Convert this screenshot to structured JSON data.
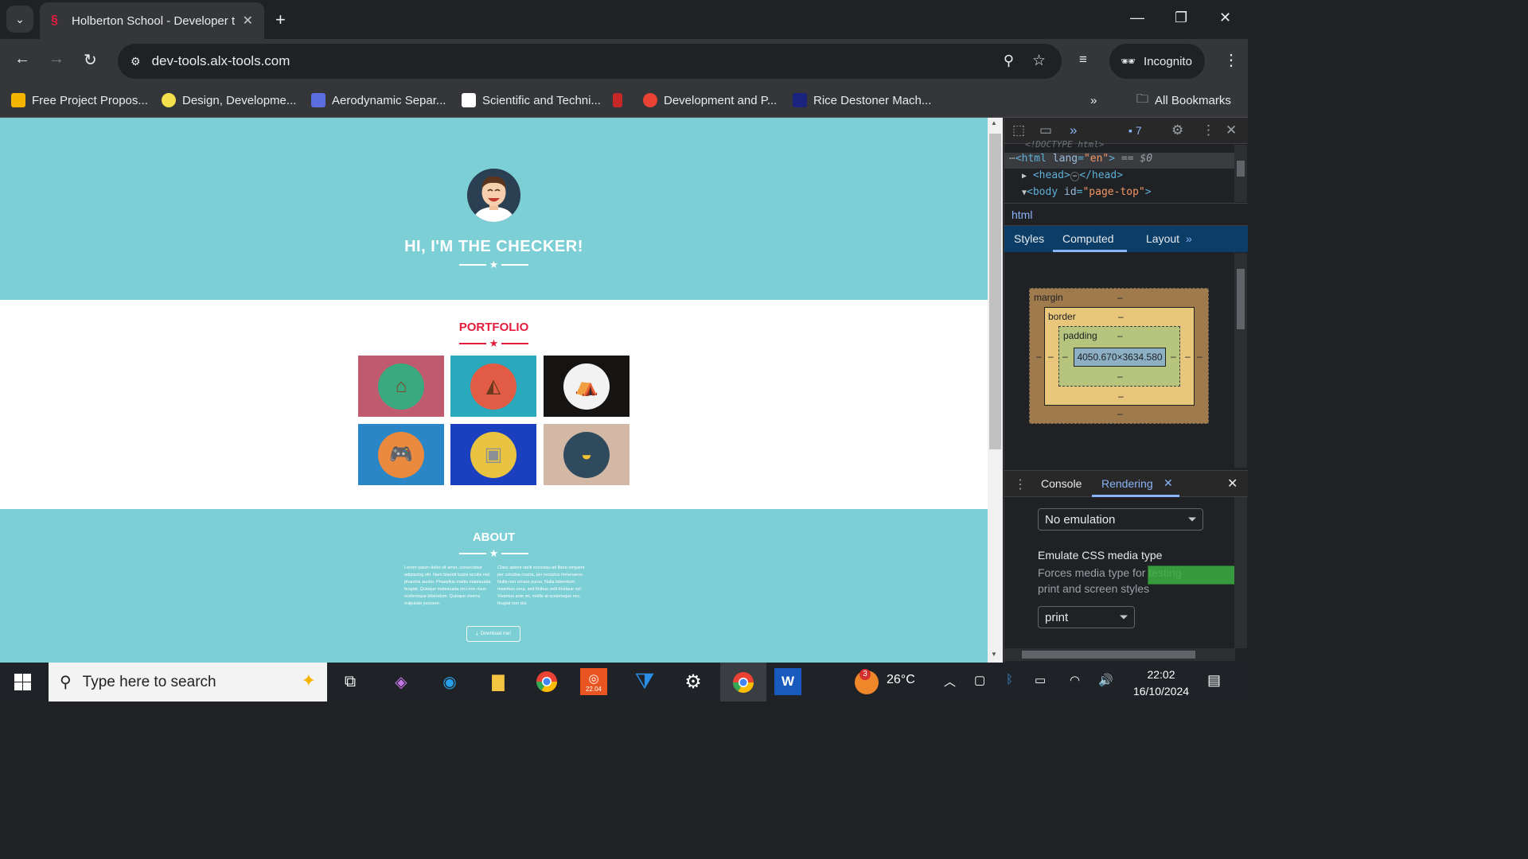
{
  "browser": {
    "tab_title": "Holberton School - Developer t",
    "url": "dev-tools.alx-tools.com",
    "incognito_label": "Incognito",
    "bookmarks": [
      {
        "label": "Free Project Propos...",
        "color": "#f4b400"
      },
      {
        "label": "Design, Developme...",
        "color": "#f4e04d"
      },
      {
        "label": "Aerodynamic Separ...",
        "color": "#5b6ee1"
      },
      {
        "label": "Scientific and Techni...",
        "color": "#ffffff"
      },
      {
        "label": "",
        "color": "#c62828"
      },
      {
        "label": "Development and P...",
        "color": "#ea4335"
      },
      {
        "label": "Rice Destoner Mach...",
        "color": "#1a237e"
      }
    ],
    "all_bookmarks_label": "All Bookmarks"
  },
  "page": {
    "hero_title": "HI, I'M THE CHECKER!",
    "portfolio_title": "PORTFOLIO",
    "portfolio_items": [
      {
        "name": "cabin",
        "bg": "#c05a6f",
        "circle": "#3aa97f",
        "glyph": "⌂"
      },
      {
        "name": "cake",
        "bg": "#2aa9bd",
        "circle": "#e25b45",
        "glyph": "◭"
      },
      {
        "name": "circus",
        "bg": "#161313",
        "circle": "#f2f2f2",
        "glyph": "⛺"
      },
      {
        "name": "game",
        "bg": "#2a86c7",
        "circle": "#ea8a3e",
        "glyph": "🎮"
      },
      {
        "name": "safe",
        "bg": "#1a3fbf",
        "circle": "#e9c443",
        "glyph": "▣"
      },
      {
        "name": "submarine",
        "bg": "#d3b8a6",
        "circle": "#2e4a5c",
        "glyph": "◒"
      }
    ],
    "about_title": "ABOUT",
    "about_left": "Lorem ipsum dolor sit amet, consectetur adipiscing elit. Nam blandit turpis iaculis nisl pharetra auctor. Phasellus mattis malesuada feugiat. Quisque malesuada orci non risus scelerisque bibendum. Quisque viverra vulputate posuere.",
    "about_right": "Class aptent taciti sociosqu ad litora torquent per conubia nostra, per inceptos himenaeos. Nulla non ornare purus. Nulla bibendum maximus urna, sed finibus velit tristique vel. Vivamus ante mi, mollis at scelerisque nec, feugiat non dui.",
    "download_label": "Download me!"
  },
  "devtools": {
    "issues_count": "7",
    "doctype_line": "<!DOCTYPE html>",
    "html_line": {
      "tag_open": "<html",
      "attr": " lang",
      "eq": "=",
      "val": "\"en\"",
      "close": ">",
      "sel": " == $0"
    },
    "head_line": "<head>",
    "head_close": "</head>",
    "body_line": {
      "tag_open": "<body",
      "attr": " id",
      "eq": "=",
      "val": "\"page-top\"",
      "close": ">"
    },
    "breadcrumb": "html",
    "tabs": [
      "Styles",
      "Computed",
      "Layout"
    ],
    "box_model": {
      "margin_label": "margin",
      "border_label": "border",
      "padding_label": "padding",
      "dash": "–",
      "content_size": "4050.670×3634.580"
    },
    "drawer_tabs": [
      "Console",
      "Rendering"
    ],
    "emulation_select": "No emulation",
    "media_heading": "Emulate CSS media type",
    "media_desc": "Forces media type for testing print and screen styles",
    "media_select": "print"
  },
  "taskbar": {
    "search_placeholder": "Type here to search",
    "weather": "26°C",
    "weather_badge": "3",
    "time": "22:02",
    "date": "16/10/2024",
    "ubuntu_label": "22.04"
  }
}
